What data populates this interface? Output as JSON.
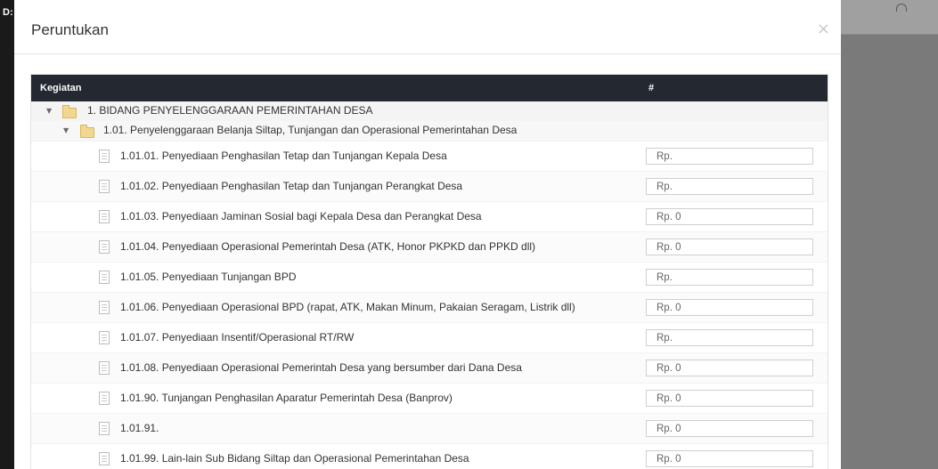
{
  "background": {
    "left_cut_text": "D:"
  },
  "modal": {
    "title": "Peruntukan",
    "close_label": "×"
  },
  "table": {
    "headers": {
      "activity": "Kegiatan",
      "amount": "#"
    },
    "groups": [
      {
        "label": "1. BIDANG PENYELENGGARAAN PEMERINTAHAN DESA"
      },
      {
        "label": "1.01. Penyelenggaraan Belanja Siltap, Tunjangan dan Operasional Pemerintahan Desa"
      }
    ],
    "items": [
      {
        "label": "1.01.01. Penyediaan Penghasilan Tetap dan Tunjangan Kepala Desa",
        "value": "Rp."
      },
      {
        "label": "1.01.02. Penyediaan Penghasilan Tetap dan Tunjangan Perangkat Desa",
        "value": "Rp."
      },
      {
        "label": "1.01.03. Penyediaan Jaminan Sosial bagi Kepala Desa dan Perangkat Desa",
        "value": "Rp. 0"
      },
      {
        "label": "1.01.04. Penyediaan Operasional Pemerintah Desa (ATK, Honor PKPKD dan PPKD dll)",
        "value": "Rp. 0"
      },
      {
        "label": "1.01.05. Penyediaan Tunjangan BPD",
        "value": "Rp."
      },
      {
        "label": "1.01.06. Penyediaan Operasional BPD (rapat, ATK, Makan Minum, Pakaian Seragam, Listrik dll)",
        "value": "Rp. 0"
      },
      {
        "label": "1.01.07. Penyediaan Insentif/Operasional RT/RW",
        "value": "Rp."
      },
      {
        "label": "1.01.08. Penyediaan Operasional Pemerintah Desa yang bersumber dari Dana Desa",
        "value": "Rp. 0"
      },
      {
        "label": "1.01.90. Tunjangan Penghasilan Aparatur Pemerintah Desa (Banprov)",
        "value": "Rp. 0"
      },
      {
        "label": "1.01.91.",
        "value": "Rp. 0"
      },
      {
        "label": "1.01.99. Lain-lain Sub Bidang Siltap dan Operasional Pemerintahan Desa",
        "value": "Rp. 0"
      }
    ]
  },
  "colors": {
    "table_header_bg": "#232831",
    "folder": "#f2d791",
    "overlay": "#7a7a7a"
  }
}
